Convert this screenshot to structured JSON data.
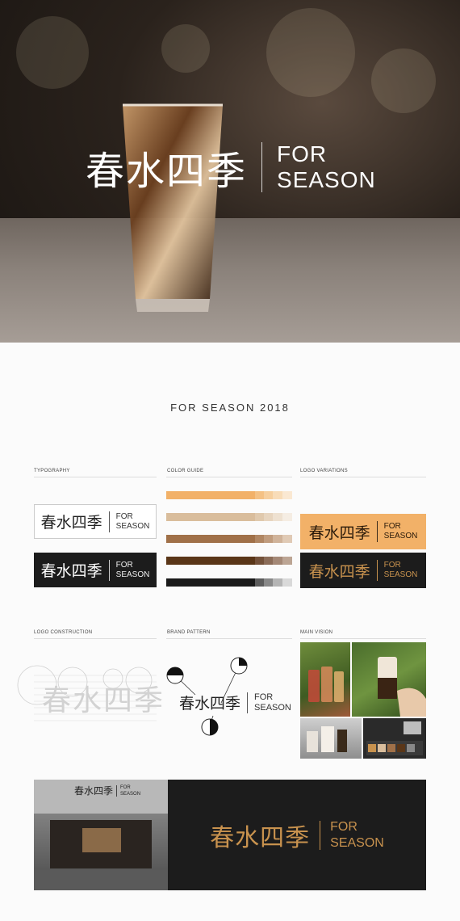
{
  "hero": {
    "logo_cn": "春水四季",
    "logo_en_line1": "FOR",
    "logo_en_line2": "SEASON"
  },
  "header": {
    "title": "FOR SEASON  2018"
  },
  "sections": {
    "typography": "TYPOGRAPHY",
    "color_guide": "COLOR GUIDE",
    "logo_variations": "LOGO VARIATIONS",
    "logo_construction": "LOGO CONSTRUCTION",
    "brand_pattern": "BRAND PATTERN",
    "main_vision": "MAIN VISION"
  },
  "logo": {
    "cn": "春水四季",
    "en1": "FOR",
    "en2": "SEASON"
  },
  "colors": {
    "orange": [
      "#f2b168",
      "#f4c184",
      "#f6cf9e",
      "#f8dcb8",
      "#fae8d2"
    ],
    "beige": [
      "#d9bd9c",
      "#e0c9ad",
      "#e7d5bf",
      "#eee1d1",
      "#f5ede3"
    ],
    "brown": [
      "#a07048",
      "#b08663",
      "#c09c7e",
      "#d0b39a",
      "#e0cab5"
    ],
    "dark_brown": [
      "#5a3618",
      "#73513a",
      "#8b6c58",
      "#a48876",
      "#bca594"
    ],
    "black": [
      "#1a1a1a",
      "#5c5c5c",
      "#888888",
      "#b4b4b4",
      "#d9d9d9"
    ],
    "gold": "#c8924e",
    "dark_bg": "#1c1c1c"
  }
}
